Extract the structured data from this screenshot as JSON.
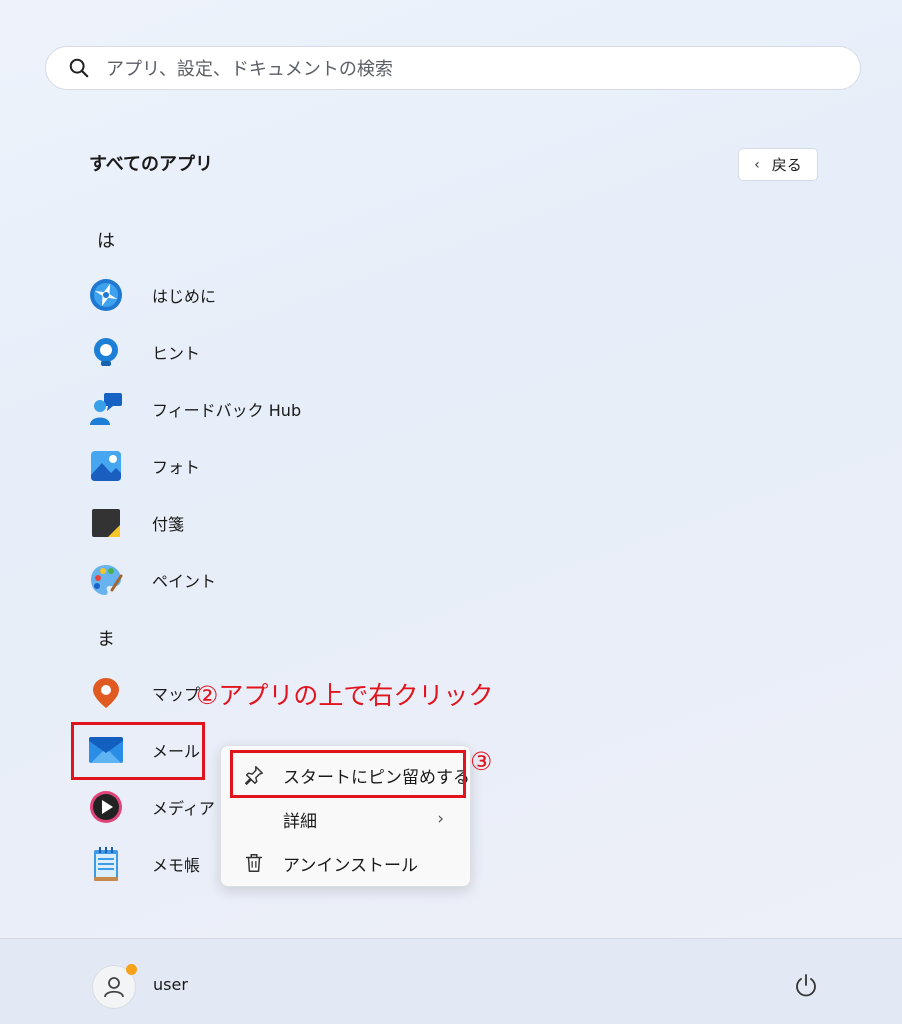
{
  "search": {
    "placeholder": "アプリ、設定、ドキュメントの検索"
  },
  "header": {
    "title": "すべてのアプリ",
    "back_label": "戻る"
  },
  "sections": [
    {
      "letter": "は",
      "apps": [
        "はじめに",
        "ヒント",
        "フィードバック Hub",
        "フォト",
        "付箋",
        "ペイント"
      ]
    },
    {
      "letter": "ま",
      "apps": [
        "マップ",
        "メール",
        "メディア プ",
        "メモ帳"
      ]
    }
  ],
  "context_menu": {
    "items": [
      "スタートにピン留めする",
      "詳細",
      "アンインストール"
    ]
  },
  "annotations": {
    "step2": "②アプリの上で右クリック",
    "step3": "③"
  },
  "footer": {
    "user": "user"
  },
  "colors": {
    "annotation_red": "#e1141e",
    "status_dot": "#f7a21b"
  },
  "icons": [
    "search-icon",
    "chevron-left-icon",
    "pin-icon",
    "chevron-right-icon",
    "trash-icon",
    "person-icon",
    "power-icon"
  ]
}
